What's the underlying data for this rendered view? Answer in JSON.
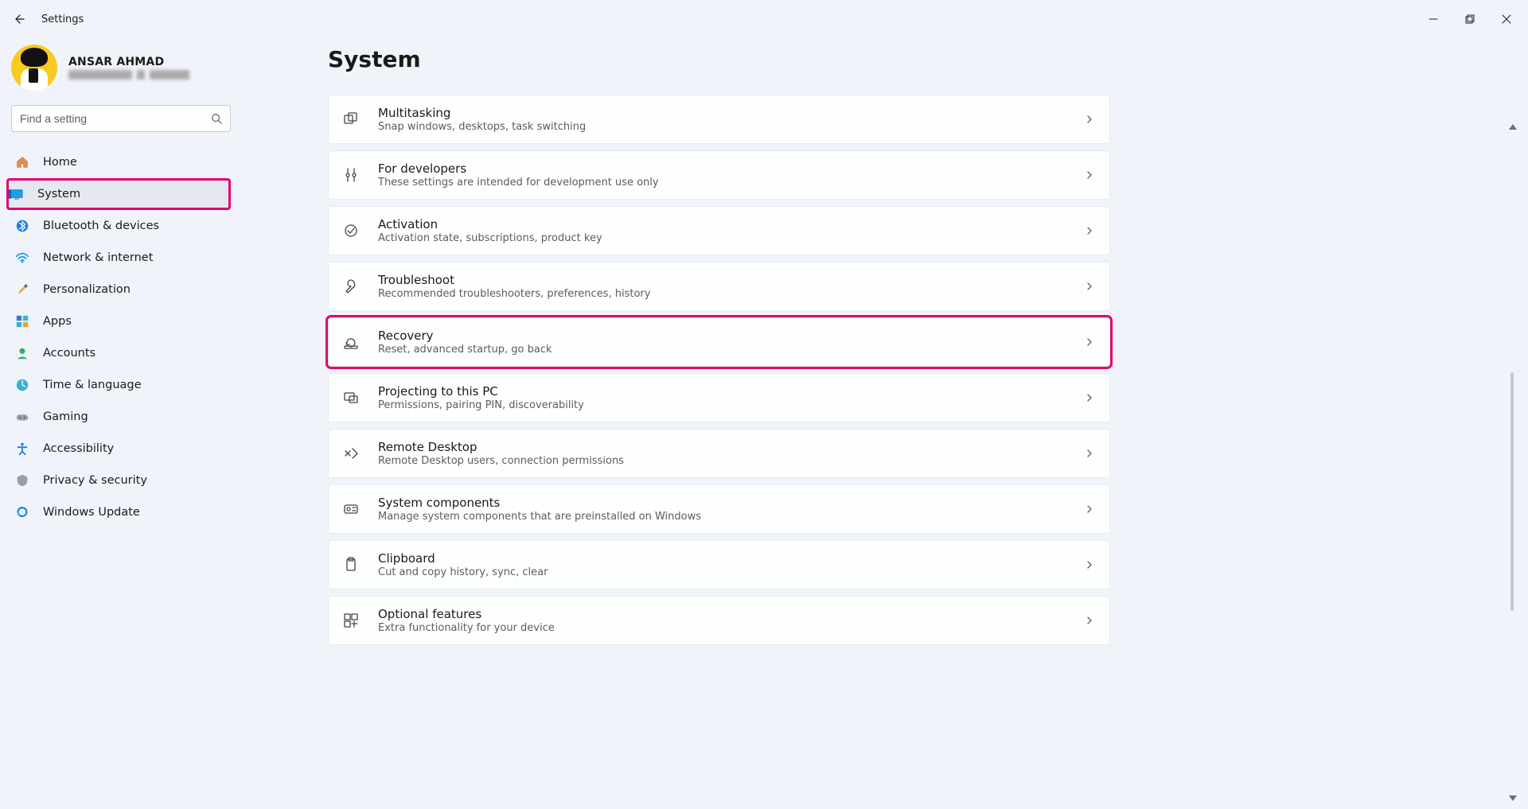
{
  "window": {
    "title": "Settings"
  },
  "profile": {
    "name": "ANSAR AHMAD"
  },
  "search": {
    "placeholder": "Find a setting"
  },
  "page": {
    "title": "System"
  },
  "nav": {
    "items": [
      {
        "label": "Home"
      },
      {
        "label": "System"
      },
      {
        "label": "Bluetooth & devices"
      },
      {
        "label": "Network & internet"
      },
      {
        "label": "Personalization"
      },
      {
        "label": "Apps"
      },
      {
        "label": "Accounts"
      },
      {
        "label": "Time & language"
      },
      {
        "label": "Gaming"
      },
      {
        "label": "Accessibility"
      },
      {
        "label": "Privacy & security"
      },
      {
        "label": "Windows Update"
      }
    ]
  },
  "cards": [
    {
      "title": "Multitasking",
      "desc": "Snap windows, desktops, task switching"
    },
    {
      "title": "For developers",
      "desc": "These settings are intended for development use only"
    },
    {
      "title": "Activation",
      "desc": "Activation state, subscriptions, product key"
    },
    {
      "title": "Troubleshoot",
      "desc": "Recommended troubleshooters, preferences, history"
    },
    {
      "title": "Recovery",
      "desc": "Reset, advanced startup, go back"
    },
    {
      "title": "Projecting to this PC",
      "desc": "Permissions, pairing PIN, discoverability"
    },
    {
      "title": "Remote Desktop",
      "desc": "Remote Desktop users, connection permissions"
    },
    {
      "title": "System components",
      "desc": "Manage system components that are preinstalled on Windows"
    },
    {
      "title": "Clipboard",
      "desc": "Cut and copy history, sync, clear"
    },
    {
      "title": "Optional features",
      "desc": "Extra functionality for your device"
    }
  ],
  "highlights": {
    "nav_selected_index": 1,
    "card_highlight_index": 4
  }
}
